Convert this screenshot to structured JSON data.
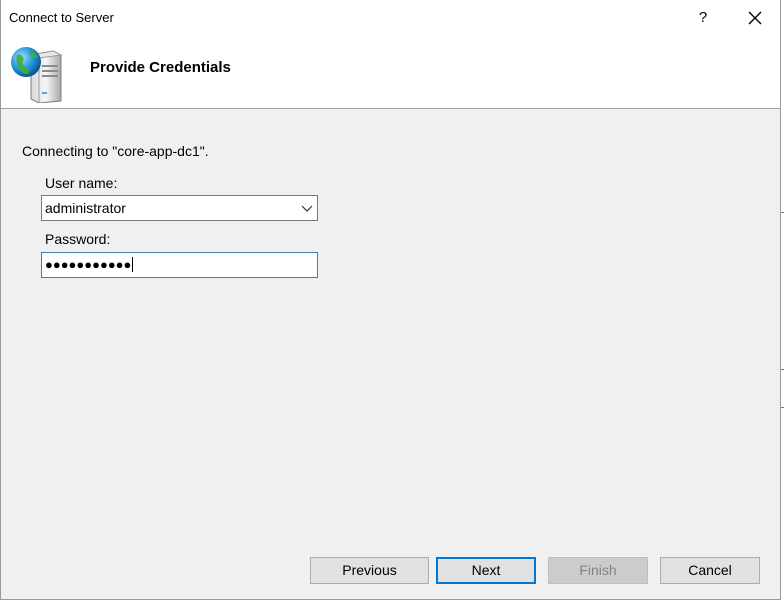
{
  "window": {
    "title": "Connect to Server",
    "help_label": "?"
  },
  "header": {
    "title": "Provide Credentials",
    "icon": "server-globe-icon"
  },
  "content": {
    "connecting_text": "Connecting to \"core-app-dc1\".",
    "username_label": "User name:",
    "username_value": "administrator",
    "password_label": "Password:",
    "password_masked": "●●●●●●●●●●●"
  },
  "buttons": {
    "previous": "Previous",
    "next": "Next",
    "finish": "Finish",
    "cancel": "Cancel"
  },
  "colors": {
    "focus_border": "#3c7fb1",
    "default_button_border": "#0078d7",
    "dialog_background": "#f0f0f0"
  }
}
